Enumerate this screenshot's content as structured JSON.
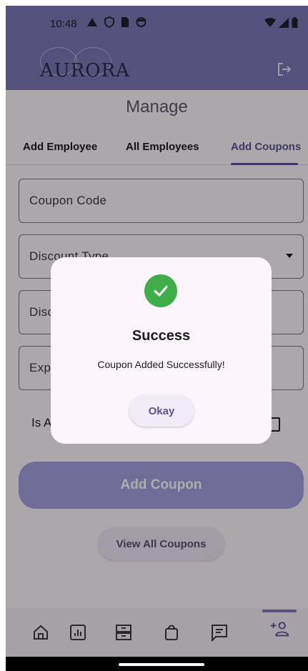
{
  "status_bar": {
    "time": "10:48",
    "left_icons": [
      "warning-icon",
      "shield-icon",
      "sim-card-icon",
      "circle-notification-icon"
    ],
    "right_icons": [
      "wifi-icon",
      "signal-icon",
      "battery-icon"
    ]
  },
  "app_bar": {
    "logo_text": "AURORA",
    "logout_icon": "logout-icon",
    "color": "#7e78b8"
  },
  "page": {
    "title": "Manage",
    "tabs": [
      {
        "label": "Add Employee",
        "active": false
      },
      {
        "label": "All Employees",
        "active": false
      },
      {
        "label": "Add Coupons",
        "active": true
      }
    ]
  },
  "form": {
    "coupon_code_label": "Coupon Code",
    "discount_type_label": "Discount Type",
    "discount_value_label": "Disc",
    "expiry_label": "Exp",
    "is_active_label": "Is A",
    "is_active_checked": false,
    "add_button_label": "Add Coupon",
    "view_all_button_label": "View All Coupons"
  },
  "bottom_nav": {
    "items": [
      {
        "icon": "home-icon",
        "active": false
      },
      {
        "icon": "chart-icon",
        "active": false
      },
      {
        "icon": "inventory-icon",
        "active": false
      },
      {
        "icon": "shopping-bag-icon",
        "active": false
      },
      {
        "icon": "message-icon",
        "active": false
      },
      {
        "icon": "add-person-icon",
        "active": true
      }
    ]
  },
  "dialog": {
    "icon": "check-circle-icon",
    "title": "Success",
    "message": "Coupon Added Successfully!",
    "button_label": "Okay",
    "accent_color": "#3fae49"
  }
}
